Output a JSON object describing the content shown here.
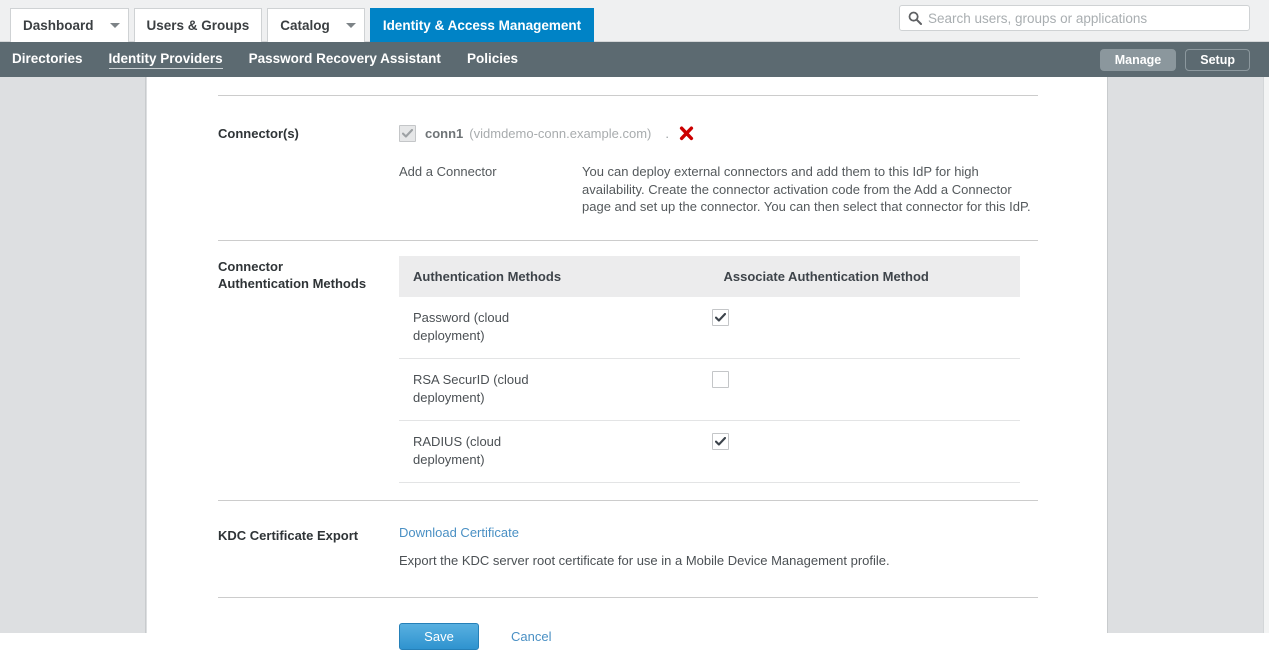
{
  "topbar": {
    "tabs": [
      {
        "label": "Dashboard",
        "caret": true,
        "active": false
      },
      {
        "label": "Users & Groups",
        "caret": false,
        "active": false
      },
      {
        "label": "Catalog",
        "caret": true,
        "active": false
      },
      {
        "label": "Identity & Access Management",
        "caret": false,
        "active": true
      }
    ],
    "search": {
      "placeholder": "Search users, groups or applications",
      "value": "",
      "icon": "search-icon"
    }
  },
  "subnav": {
    "links": [
      {
        "label": "Directories",
        "active": false
      },
      {
        "label": "Identity Providers",
        "active": true
      },
      {
        "label": "Password Recovery Assistant",
        "active": false
      },
      {
        "label": "Policies",
        "active": false
      }
    ],
    "buttons": [
      {
        "label": "Manage",
        "selected": true
      },
      {
        "label": "Setup",
        "selected": false
      }
    ]
  },
  "form": {
    "connectors": {
      "label": "Connector(s)",
      "items": [
        {
          "name": "conn1",
          "host": "(vidmdemo-conn.example.com)",
          "checked": true,
          "disabled": true,
          "separator": ".",
          "delete_icon": "delete-x-icon"
        }
      ],
      "add_link": "Add a Connector",
      "description": "You can deploy external connectors and add them to this IdP for high availability. Create the connector activation code from the Add a Connector page and set up the connector. You can then select that connector for this IdP."
    },
    "auth_methods": {
      "label_line1": "Connector",
      "label_line2": "Authentication Methods",
      "columns": [
        "Authentication Methods",
        "Associate Authentication Method"
      ],
      "rows": [
        {
          "method": "Password (cloud deployment)",
          "associated": true
        },
        {
          "method": "RSA SecurID (cloud deployment)",
          "associated": false
        },
        {
          "method": "RADIUS (cloud deployment)",
          "associated": true
        }
      ]
    },
    "kdc": {
      "label": "KDC Certificate Export",
      "link": "Download Certificate",
      "description": "Export the KDC server root certificate for use in a Mobile Device Management profile."
    },
    "actions": {
      "save": "Save",
      "cancel": "Cancel"
    }
  },
  "colors": {
    "accent_blue": "#0083c6",
    "subnav_slate": "#5c6a71",
    "link_blue": "#4a90c4",
    "delete_red": "#cc0000",
    "save_blue": "#2f93cf"
  }
}
